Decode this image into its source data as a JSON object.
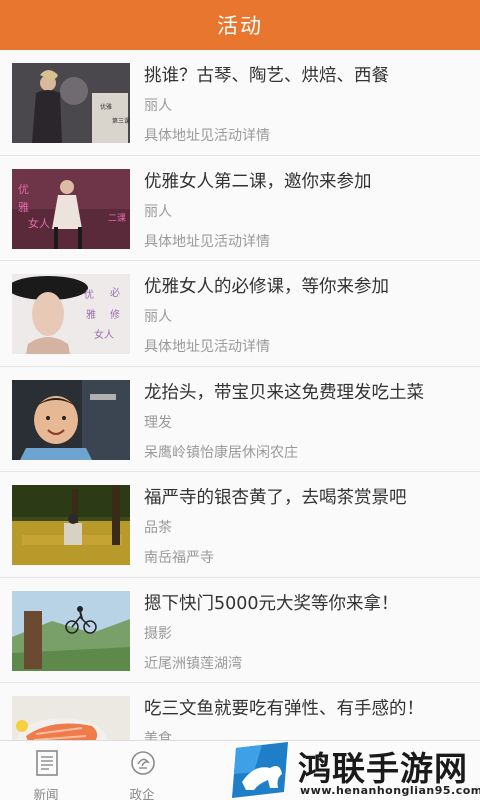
{
  "header": {
    "title": "活动"
  },
  "activities": [
    {
      "title": "挑谁？古琴、陶艺、烘焙、西餐",
      "category": "丽人",
      "location": "具体地址见活动详情",
      "thumb_text": "优雅女人 第三课"
    },
    {
      "title": "优雅女人第二课，邀你来参加",
      "category": "丽人",
      "location": "具体地址见活动详情",
      "thumb_text": "优雅女人 第二课"
    },
    {
      "title": "优雅女人的必修课，等你来参加",
      "category": "丽人",
      "location": "具体地址见活动详情",
      "thumb_text": "优雅女人 必修课"
    },
    {
      "title": "龙抬头，带宝贝来这免费理发吃土菜",
      "category": "理发",
      "location": "呆鹰岭镇怡康居休闲农庄"
    },
    {
      "title": "福严寺的银杏黄了，去喝茶赏景吧",
      "category": "品茶",
      "location": "南岳福严寺"
    },
    {
      "title": "摁下快门5000元大奖等你来拿！",
      "category": "摄影",
      "location": "近尾洲镇莲湖湾"
    },
    {
      "title": "吃三文鱼就要吃有弹性、有手感的！",
      "category": "美食",
      "location": ""
    }
  ],
  "tabs": [
    {
      "label": "新闻",
      "icon": "newspaper-icon"
    },
    {
      "label": "政企",
      "icon": "government-icon"
    }
  ],
  "watermark": {
    "text": "鸿联手游网",
    "url": "www.henanhonglian95.com"
  },
  "colors": {
    "header_bg": "#e9762e",
    "text_main": "#333333",
    "text_sub": "#9a9a9a"
  }
}
